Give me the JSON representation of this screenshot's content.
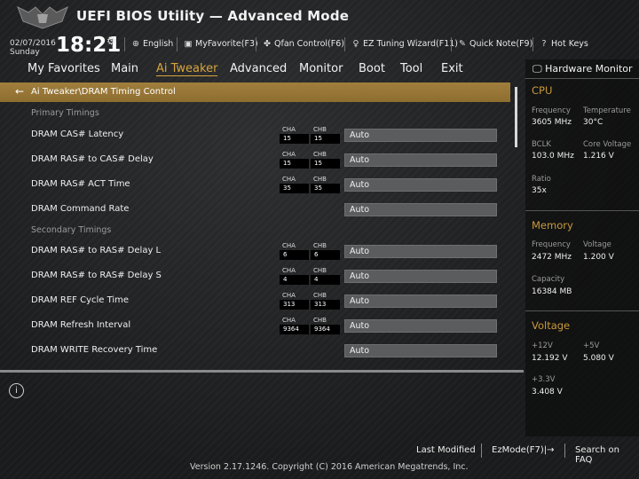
{
  "header": {
    "title": "UEFI BIOS Utility — Advanced Mode",
    "date": "02/07/2016",
    "day": "Sunday",
    "time": "18:21",
    "toolbar": [
      {
        "icon": "globe-icon",
        "label": "English"
      },
      {
        "icon": "favorite-icon",
        "label": "MyFavorite(F3)"
      },
      {
        "icon": "fan-icon",
        "label": "Qfan Control(F6)"
      },
      {
        "icon": "lightbulb-icon",
        "label": "EZ Tuning Wizard(F11)"
      },
      {
        "icon": "note-icon",
        "label": "Quick Note(F9)"
      },
      {
        "icon": "help-icon",
        "label": "Hot Keys"
      }
    ]
  },
  "menu": {
    "items": [
      "My Favorites",
      "Main",
      "Ai Tweaker",
      "Advanced",
      "Monitor",
      "Boot",
      "Tool",
      "Exit"
    ],
    "active": "Ai Tweaker"
  },
  "breadcrumb": "Ai Tweaker\\DRAM Timing Control",
  "sections": {
    "primary": "Primary Timings",
    "secondary": "Secondary Timings"
  },
  "channel_labels": {
    "a": "CHA",
    "b": "CHB"
  },
  "rows": [
    {
      "label": "DRAM CAS# Latency",
      "cha": "15",
      "chb": "15",
      "value": "Auto"
    },
    {
      "label": "DRAM RAS# to CAS# Delay",
      "cha": "15",
      "chb": "15",
      "value": "Auto"
    },
    {
      "label": "DRAM RAS# ACT Time",
      "cha": "35",
      "chb": "35",
      "value": "Auto"
    },
    {
      "label": "DRAM Command Rate",
      "value": "Auto"
    },
    {
      "label": "DRAM RAS# to RAS# Delay L",
      "cha": "6",
      "chb": "6",
      "value": "Auto"
    },
    {
      "label": "DRAM RAS# to RAS# Delay S",
      "cha": "4",
      "chb": "4",
      "value": "Auto"
    },
    {
      "label": "DRAM REF Cycle Time",
      "cha": "313",
      "chb": "313",
      "value": "Auto"
    },
    {
      "label": "DRAM Refresh Interval",
      "cha": "9364",
      "chb": "9364",
      "value": "Auto"
    },
    {
      "label": "DRAM WRITE Recovery Time",
      "value": "Auto"
    }
  ],
  "hardware_monitor": {
    "title": "Hardware Monitor",
    "cpu": {
      "heading": "CPU",
      "frequency_label": "Frequency",
      "frequency": "3605 MHz",
      "temperature_label": "Temperature",
      "temperature": "30°C",
      "bclk_label": "BCLK",
      "bclk": "103.0 MHz",
      "core_voltage_label": "Core Voltage",
      "core_voltage": "1.216 V",
      "ratio_label": "Ratio",
      "ratio": "35x"
    },
    "memory": {
      "heading": "Memory",
      "frequency_label": "Frequency",
      "frequency": "2472 MHz",
      "voltage_label": "Voltage",
      "voltage": "1.200 V",
      "capacity_label": "Capacity",
      "capacity": "16384 MB"
    },
    "voltage": {
      "heading": "Voltage",
      "v12_label": "+12V",
      "v12": "12.192 V",
      "v5_label": "+5V",
      "v5": "5.080 V",
      "v33_label": "+3.3V",
      "v33": "3.408 V"
    }
  },
  "footer": {
    "last_modified": "Last Modified",
    "ezmode": "EzMode(F7)|→",
    "search": "Search on FAQ",
    "copyright": "Version 2.17.1246. Copyright (C) 2016 American Megatrends, Inc."
  },
  "colors": {
    "accent": "#d8a53c",
    "breadcrumb_bg": "#937234",
    "field_bg": "#5b5c5d"
  }
}
